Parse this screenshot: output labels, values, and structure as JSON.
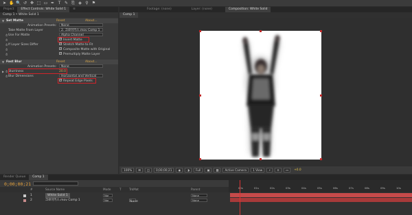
{
  "toolbar": {
    "tools": [
      "➤",
      "✋",
      "🔍",
      "↺",
      "✥",
      "⬚",
      "▭",
      "✒",
      "T",
      "✎",
      "⎘",
      "◈",
      "⚲",
      "⚑"
    ]
  },
  "effects_panel": {
    "tabs": [
      "Project",
      "Effect Controls: White Solid 1",
      "≡"
    ],
    "breadcrumb": "Comp 1 • White Solid 1",
    "set_matte": {
      "name": "Set Matte",
      "reset": "Reset",
      "about": "About...",
      "animation_presets_label": "Animation Presets:",
      "animation_presets_value": "None",
      "take_matte_label": "Take Matte From Layer",
      "take_matte_value": "2. 크로마키스.mov Comp 1",
      "use_for_matte_label": "Use For Matte",
      "use_for_matte_value": "Alpha Channel",
      "invert_matte": "Invert Matte",
      "stretch_matte": "Stretch Matte to Fit",
      "if_layer_sizes_differ": "If Layer Sizes Differ",
      "composite_matte": "Composite Matte with Original",
      "premultiply": "Premultiply Matte Layer"
    },
    "fast_blur": {
      "name": "Fast Blur",
      "reset": "Reset",
      "about": "About...",
      "animation_presets_label": "Animation Presets:",
      "animation_presets_value": "None",
      "blurriness_label": "Blurriness",
      "blurriness_value": "20.0",
      "blur_dimensions_label": "Blur Dimensions",
      "blur_dimensions_value": "Horizontal and Vertical",
      "repeat_edge": "Repeat Edge Pixels"
    }
  },
  "viewer": {
    "tabs": [
      "Footage: (none)",
      "Layer: (none)",
      "Composition: White Solid"
    ],
    "comp_tab": "Comp 1",
    "zoom": "100%",
    "time": "0;00;00;21",
    "resolution": "Full",
    "camera": "Active Camera",
    "views": "1 View",
    "exposure": "+0.0"
  },
  "timeline": {
    "tabs": [
      "Render Queue",
      "Comp 1"
    ],
    "timecode": "0;00;00;21",
    "columns": [
      "#",
      "Source Name",
      "Mode",
      "T",
      "TrkMat",
      "Parent"
    ],
    "layers": [
      {
        "num": "1",
        "name": "White Solid 1",
        "mode": "Nor",
        "trkmat": "",
        "parent": "None",
        "color": "#c9c9c9"
      },
      {
        "num": "2",
        "name": "크로마키스.mov Comp 1",
        "mode": "Nor",
        "trkmat": "None",
        "parent": "None",
        "color": "#c78b8b"
      }
    ],
    "ruler_ticks": [
      "00s",
      "01s",
      "02s",
      "03s",
      "04s",
      "05s",
      "06s",
      "07s",
      "08s",
      "09s",
      "10s"
    ]
  }
}
